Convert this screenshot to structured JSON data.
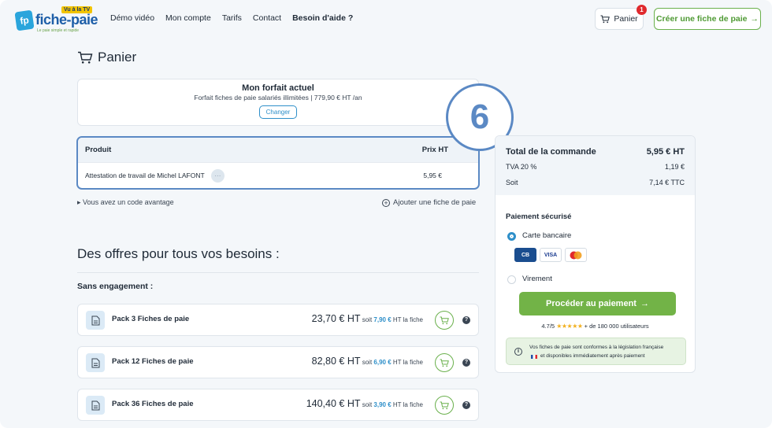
{
  "header": {
    "logo": {
      "brand": "fiche-paie",
      "badge": "Vu à la TV",
      "tagline": "Le paie simple et rapide",
      "mark": "fp"
    },
    "nav": [
      "Démo vidéo",
      "Mon compte",
      "Tarifs",
      "Contact",
      "Besoin d'aide ?"
    ],
    "cart_label": "Panier",
    "cart_count": "1",
    "create_label": "Créer une fiche de paie",
    "accent": "#72b347"
  },
  "page_title": "Panier",
  "plan": {
    "title": "Mon forfait actuel",
    "subtitle": "Forfait fiches de paie salariés illimitées | 779,90 € HT /an",
    "change_label": "Changer"
  },
  "step_badge": "6",
  "table": {
    "col_product": "Produit",
    "col_price": "Prix HT",
    "rows": [
      {
        "product": "Attestation de travail de Michel LAFONT",
        "menu": "···",
        "price": "5,95 €"
      }
    ]
  },
  "promo_link": "Vous avez un code avantage",
  "add_sheet": "Ajouter une fiche de paie",
  "offers_title": "Des offres pour tous vos besoins :",
  "no_commit": "Sans engagement :",
  "offers": [
    {
      "name": "Pack 3 Fiches de paie",
      "price": "23,70 € HT",
      "soit": "soit",
      "unit": "7,90 €",
      "unit_suffix": "HT la fiche"
    },
    {
      "name": "Pack 12 Fiches de paie",
      "price": "82,80 € HT",
      "soit": "soit",
      "unit": "6,90 €",
      "unit_suffix": "HT la fiche"
    },
    {
      "name": "Pack 36 Fiches de paie",
      "price": "140,40 € HT",
      "soit": "soit",
      "unit": "3,90 €",
      "unit_suffix": "HT la fiche"
    }
  ],
  "summary": {
    "total_label": "Total de la commande",
    "total_value": "5,95 € HT",
    "tva_label": "TVA 20 %",
    "tva_value": "1,19 €",
    "soit_label": "Soit",
    "soit_value": "7,14 € TTC",
    "pay_title": "Paiement sécurisé",
    "method_card": "Carte bancaire",
    "method_transfer": "Virement",
    "cards": [
      "CB",
      "VISA",
      "mastercard"
    ],
    "pay_button": "Procéder au paiement",
    "rating": "4.7/5",
    "stars": "★★★★★",
    "users": "+ de 180 000 utilisateurs",
    "legal_line1": "Vos fiches de paie sont conformes à la législation française",
    "legal_line2": "et disponibles immédiatement après paiement"
  }
}
